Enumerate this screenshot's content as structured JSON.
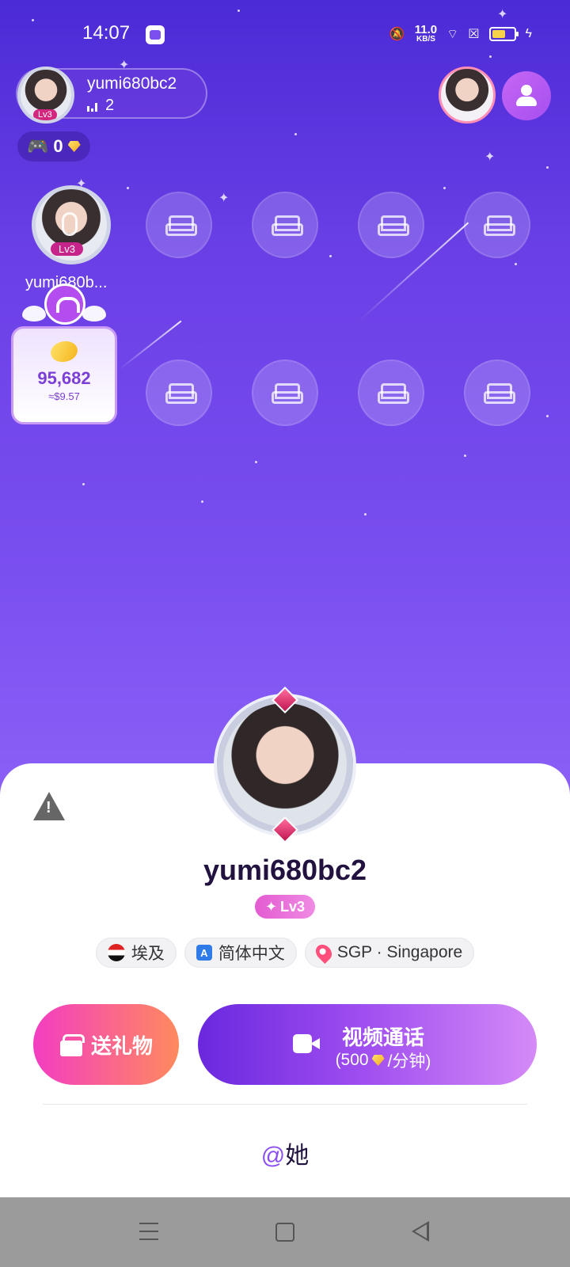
{
  "status_bar": {
    "time": "14:07",
    "net_speed_value": "11.0",
    "net_speed_unit": "KB/S",
    "icons": [
      "mute-icon",
      "wifi-icon",
      "sim-icon",
      "battery-icon",
      "charging-icon"
    ]
  },
  "room": {
    "host_name": "yumi680bc2",
    "host_level": "Lv3",
    "viewer_count": "2",
    "coin_count": "0",
    "seat_user_name": "yumi680b...",
    "seat_user_level": "Lv3",
    "gift_value": "95,682",
    "gift_usd": "≈$9.57"
  },
  "profile": {
    "name": "yumi680bc2",
    "level": "Lv3",
    "tags": [
      {
        "label": "埃及",
        "icon": "egypt-flag-icon"
      },
      {
        "label": "简体中文",
        "icon": "language-icon"
      },
      {
        "label": "SGP · Singapore",
        "icon": "location-pin-icon"
      }
    ],
    "gift_button_label": "送礼物",
    "call_button_label": "视频通话",
    "call_price_prefix": "(500",
    "call_price_suffix": "/分钟)",
    "mention_at": "@",
    "mention_label": "她"
  },
  "colors": {
    "background_top": "#4b2bd6",
    "background_bottom": "#8f66f7",
    "gift_button_start": "#f33dc2",
    "gift_button_end": "#ff8a5e",
    "call_button_start": "#6a28de",
    "call_button_end": "#d58af7",
    "accent_purple": "#8b4ff0"
  }
}
